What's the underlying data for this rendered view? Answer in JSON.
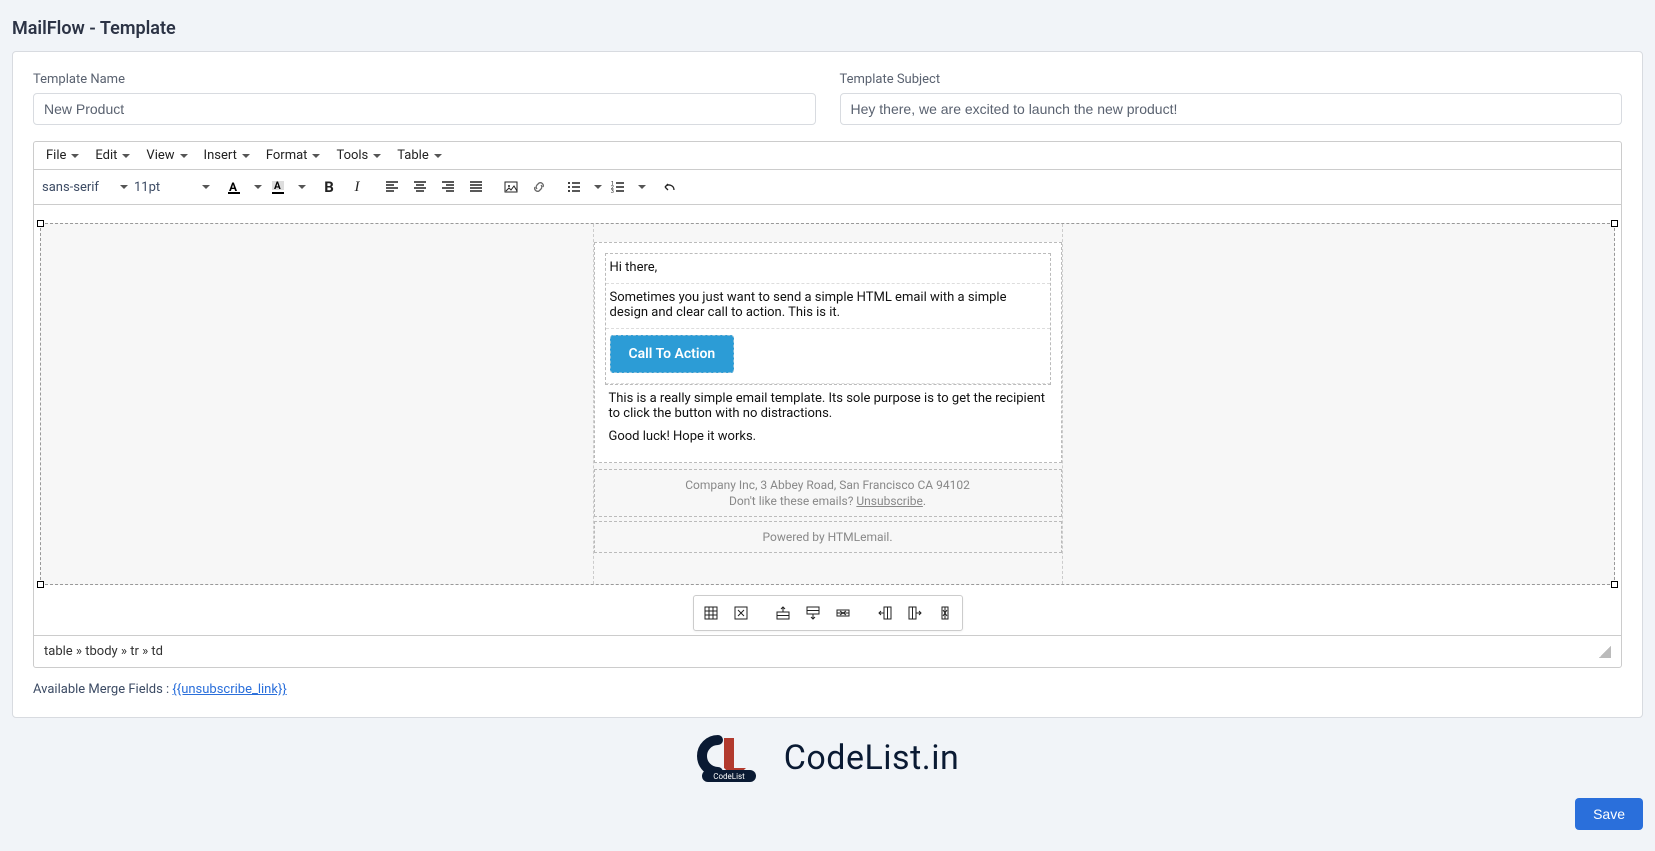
{
  "header": {
    "title": "MailFlow - Template"
  },
  "fields": {
    "name_label": "Template Name",
    "name_value": "New Product",
    "subject_label": "Template Subject",
    "subject_value": "Hey there, we are excited to launch the new product!"
  },
  "editor": {
    "menus": {
      "file": "File",
      "edit": "Edit",
      "view": "View",
      "insert": "Insert",
      "format": "Format",
      "tools": "Tools",
      "table": "Table"
    },
    "font_family": "sans-serif",
    "font_size": "11pt",
    "path": "table » tbody » tr » td"
  },
  "email": {
    "greeting": "Hi there,",
    "intro": "Sometimes you just want to send a simple HTML email with a simple design and clear call to action. This is it.",
    "cta": "Call To Action",
    "p1": "This is a really simple email template. Its sole purpose is to get the recipient to click the button with no distractions.",
    "p2": "Good luck! Hope it works.",
    "footer_addr": "Company Inc, 3 Abbey Road, San Francisco CA 94102",
    "footer_unsub_pre": "Don't like these emails? ",
    "footer_unsub_link": "Unsubscribe",
    "footer_unsub_post": ".",
    "powered": "Powered by HTMLemail."
  },
  "merge": {
    "label": "Available Merge Fields : ",
    "field": "{{unsubscribe_link}}"
  },
  "watermark": {
    "text": "CodeList.in",
    "badge_top": "CL",
    "badge_bottom": "CodeList"
  },
  "actions": {
    "save": "Save"
  }
}
